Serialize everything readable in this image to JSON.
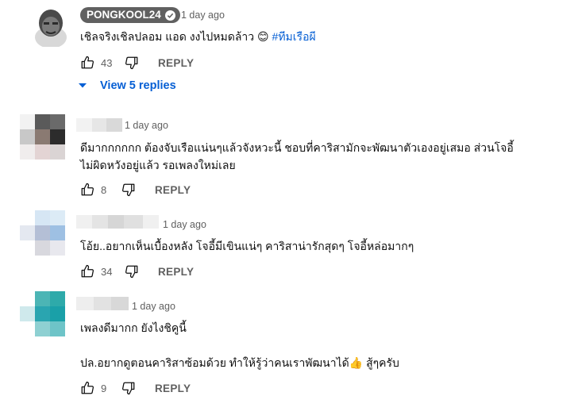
{
  "comments": [
    {
      "author": "PONGKOOL24",
      "verified": true,
      "time": "1 day ago",
      "text_lines": [
        "เชิลจริงเชิลปลอม แอด งงไปหมดล้าว 😊 "
      ],
      "hashtag": "#ทีมเรือผี",
      "likes": "43",
      "reply_label": "REPLY",
      "view_replies": "View 5 replies"
    },
    {
      "author": "",
      "time": "1 day ago",
      "text_lines": [
        "ดีมากกกกกก ต้องจับเรือแน่นๆแล้วจังหวะนี้ ชอบที่คาริสามักจะพัฒนาตัวเองอยู่เสมอ ส่วนโจอี้",
        "ไม่ผิดหวังอยู่แล้ว รอเพลงใหม่เลย"
      ],
      "likes": "8",
      "reply_label": "REPLY"
    },
    {
      "author": "",
      "time": "1 day ago",
      "text_lines": [
        "โอ้ย..อยากเห็นเบื้องหลัง โจอี้มีเขินแน่ๆ คาริสาน่ารักสุดๆ โจอี้หล่อมากๆ"
      ],
      "likes": "34",
      "reply_label": "REPLY"
    },
    {
      "author": "",
      "time": "1 day ago",
      "text_lines": [
        "เพลงดีมากก ยังไงชิคูนี้",
        "",
        "ปล.อยากดูตอนคาริสาซ้อมด้วย ทำให้รู้ว่าคนเราพัฒนาได้👍 สู้ๆครับ"
      ],
      "likes": "9",
      "reply_label": "REPLY"
    }
  ],
  "colors": {
    "link": "#065fd4",
    "secondary_text": "#606060",
    "badge_bg": "#606060"
  },
  "icons": {
    "like": "thumbs-up-icon",
    "dislike": "thumbs-down-icon",
    "expand": "chevron-down-icon",
    "verified": "check-circle-icon"
  }
}
